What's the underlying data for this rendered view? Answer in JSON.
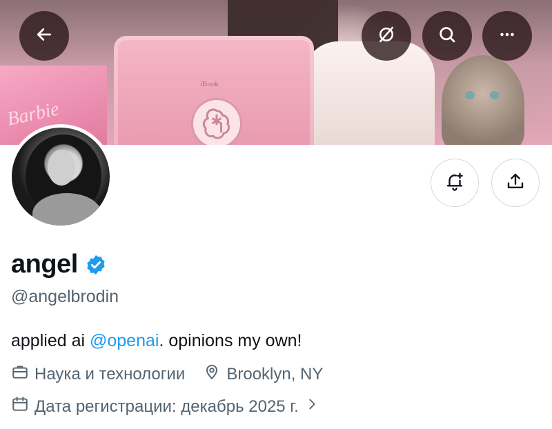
{
  "banner": {
    "laptop_label": "iBook",
    "bag_text": "Barbie"
  },
  "header": {
    "back_icon": "arrow-left-icon",
    "grok_icon": "grok-icon",
    "search_icon": "search-icon",
    "more_icon": "more-horizontal-icon"
  },
  "actions": {
    "notify_icon": "bell-plus-icon",
    "share_icon": "share-upload-icon"
  },
  "profile": {
    "name": "angel",
    "handle": "@angelbrodin",
    "verified": true,
    "bio_before": "applied ai ",
    "bio_mention": "@openai",
    "bio_after": ". opinions my own!",
    "category": "Наука и технологии",
    "location": "Brooklyn, NY",
    "joined": "Дата регистрации: декабрь 2025 г."
  },
  "colors": {
    "accent": "#1d9bf0",
    "secondary_text": "#536471",
    "primary_text": "#0f1419"
  }
}
